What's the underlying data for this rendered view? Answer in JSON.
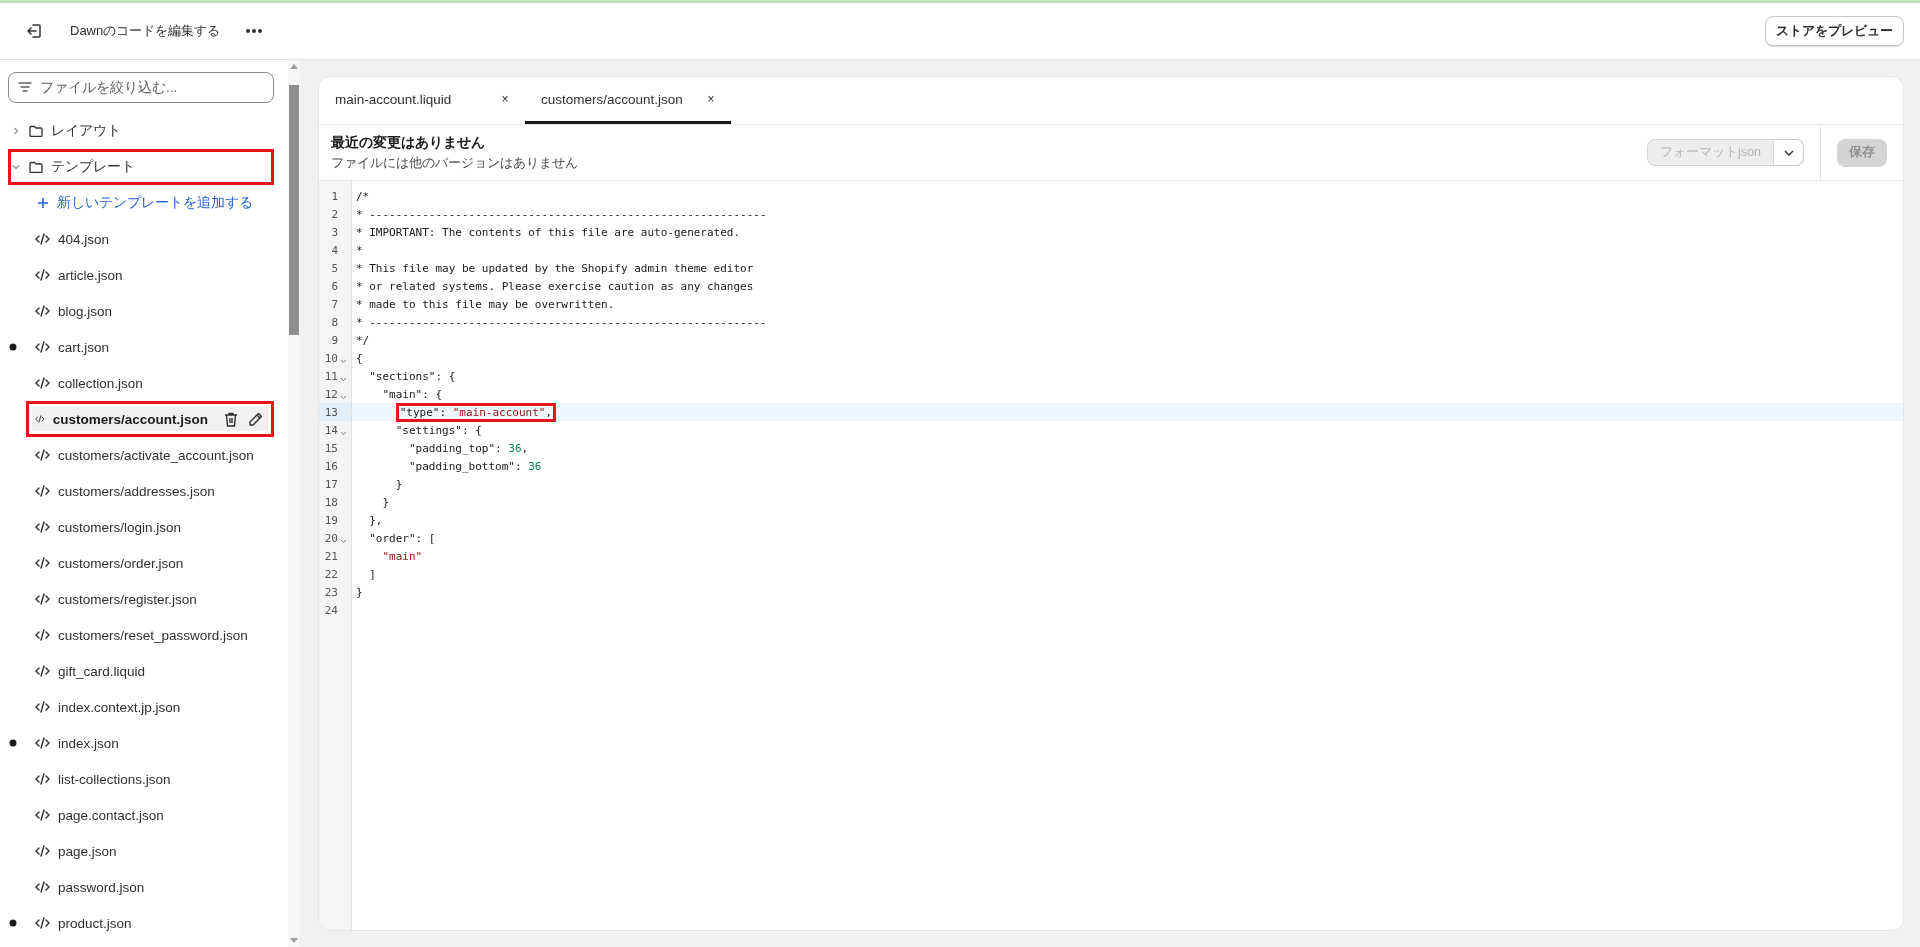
{
  "topbar": {
    "title": "Dawnのコードを編集する",
    "preview_button": "ストアをプレビュー"
  },
  "sidebar": {
    "filter": {
      "placeholder": "ファイルを絞り込む..."
    },
    "tree": [
      {
        "kind": "folder",
        "label": "レイアウト",
        "expanded": false,
        "annotated": false
      },
      {
        "kind": "folder",
        "label": "テンプレート",
        "expanded": true,
        "annotated": true,
        "children": [
          {
            "kind": "add",
            "label": "新しいテンプレートを追加する"
          },
          {
            "kind": "file",
            "label": "404.json",
            "modified": false,
            "selected": false,
            "annotated": false
          },
          {
            "kind": "file",
            "label": "article.json",
            "modified": false,
            "selected": false,
            "annotated": false
          },
          {
            "kind": "file",
            "label": "blog.json",
            "modified": false,
            "selected": false,
            "annotated": false
          },
          {
            "kind": "file",
            "label": "cart.json",
            "modified": true,
            "selected": false,
            "annotated": false
          },
          {
            "kind": "file",
            "label": "collection.json",
            "modified": false,
            "selected": false,
            "annotated": false
          },
          {
            "kind": "file",
            "label": "customers/account.json",
            "modified": false,
            "selected": true,
            "annotated": true
          },
          {
            "kind": "file",
            "label": "customers/activate_account.json",
            "modified": false,
            "selected": false,
            "annotated": false
          },
          {
            "kind": "file",
            "label": "customers/addresses.json",
            "modified": false,
            "selected": false,
            "annotated": false
          },
          {
            "kind": "file",
            "label": "customers/login.json",
            "modified": false,
            "selected": false,
            "annotated": false
          },
          {
            "kind": "file",
            "label": "customers/order.json",
            "modified": false,
            "selected": false,
            "annotated": false
          },
          {
            "kind": "file",
            "label": "customers/register.json",
            "modified": false,
            "selected": false,
            "annotated": false
          },
          {
            "kind": "file",
            "label": "customers/reset_password.json",
            "modified": false,
            "selected": false,
            "annotated": false
          },
          {
            "kind": "file",
            "label": "gift_card.liquid",
            "modified": false,
            "selected": false,
            "annotated": false
          },
          {
            "kind": "file",
            "label": "index.context.jp.json",
            "modified": false,
            "selected": false,
            "annotated": false
          },
          {
            "kind": "file",
            "label": "index.json",
            "modified": true,
            "selected": false,
            "annotated": false
          },
          {
            "kind": "file",
            "label": "list-collections.json",
            "modified": false,
            "selected": false,
            "annotated": false
          },
          {
            "kind": "file",
            "label": "page.contact.json",
            "modified": false,
            "selected": false,
            "annotated": false
          },
          {
            "kind": "file",
            "label": "page.json",
            "modified": false,
            "selected": false,
            "annotated": false
          },
          {
            "kind": "file",
            "label": "password.json",
            "modified": false,
            "selected": false,
            "annotated": false
          },
          {
            "kind": "file",
            "label": "product.json",
            "modified": true,
            "selected": false,
            "annotated": false
          }
        ]
      }
    ]
  },
  "editor": {
    "tabs": [
      {
        "label": "main-account.liquid",
        "close": "×",
        "selected": false
      },
      {
        "label": "customers/account.json",
        "close": "×",
        "selected": true
      }
    ],
    "header": {
      "title": "最近の変更はありません",
      "subtitle": "ファイルには他のバージョンはありません",
      "format_button": "フォーマットjson",
      "format_disabled": true,
      "save_button": "保存",
      "save_disabled": true
    },
    "lines": [
      {
        "number": "1",
        "tokens": [
          {
            "kind": "comment",
            "text": "/*"
          }
        ],
        "foldable": false,
        "current": false
      },
      {
        "number": "2",
        "tokens": [
          {
            "kind": "comment",
            "text": "* ------------------------------------------------------------"
          }
        ],
        "foldable": false,
        "current": false
      },
      {
        "number": "3",
        "tokens": [
          {
            "kind": "comment",
            "text": "* IMPORTANT: The contents of this file are auto-generated."
          }
        ],
        "foldable": false,
        "current": false
      },
      {
        "number": "4",
        "tokens": [
          {
            "kind": "comment",
            "text": "*"
          }
        ],
        "foldable": false,
        "current": false
      },
      {
        "number": "5",
        "tokens": [
          {
            "kind": "comment",
            "text": "* This file may be updated by the Shopify admin theme editor"
          }
        ],
        "foldable": false,
        "current": false
      },
      {
        "number": "6",
        "tokens": [
          {
            "kind": "comment",
            "text": "* or related systems. Please exercise caution as any changes"
          }
        ],
        "foldable": false,
        "current": false
      },
      {
        "number": "7",
        "tokens": [
          {
            "kind": "comment",
            "text": "* made to this file may be overwritten."
          }
        ],
        "foldable": false,
        "current": false
      },
      {
        "number": "8",
        "tokens": [
          {
            "kind": "comment",
            "text": "* ------------------------------------------------------------"
          }
        ],
        "foldable": false,
        "current": false
      },
      {
        "number": "9",
        "tokens": [
          {
            "kind": "comment",
            "text": "*/"
          }
        ],
        "foldable": false,
        "current": false
      },
      {
        "number": "10",
        "tokens": [
          {
            "kind": "punct",
            "text": "{"
          }
        ],
        "foldable": true,
        "current": false
      },
      {
        "number": "11",
        "tokens": [
          {
            "kind": "key",
            "text": "  \"sections\""
          },
          {
            "kind": "punct",
            "text": ": {"
          }
        ],
        "foldable": true,
        "current": false
      },
      {
        "number": "12",
        "tokens": [
          {
            "kind": "key",
            "text": "    \"main\""
          },
          {
            "kind": "punct",
            "text": ": {"
          }
        ],
        "foldable": true,
        "current": false
      },
      {
        "number": "13",
        "tokens": [
          {
            "kind": "annotation",
            "tokens": [
              {
                "kind": "key",
                "text": "      \"type\""
              },
              {
                "kind": "punct",
                "text": ": "
              },
              {
                "kind": "string",
                "text": "\"main-account\""
              },
              {
                "kind": "punct",
                "text": ","
              }
            ]
          }
        ],
        "foldable": false,
        "current": true
      },
      {
        "number": "14",
        "tokens": [
          {
            "kind": "key",
            "text": "      \"settings\""
          },
          {
            "kind": "punct",
            "text": ": {"
          }
        ],
        "foldable": true,
        "current": false
      },
      {
        "number": "15",
        "tokens": [
          {
            "kind": "key",
            "text": "        \"padding_top\""
          },
          {
            "kind": "punct",
            "text": ": "
          },
          {
            "kind": "number",
            "text": "36"
          },
          {
            "kind": "punct",
            "text": ","
          }
        ],
        "foldable": false,
        "current": false
      },
      {
        "number": "16",
        "tokens": [
          {
            "kind": "key",
            "text": "        \"padding_bottom\""
          },
          {
            "kind": "punct",
            "text": ": "
          },
          {
            "kind": "number",
            "text": "36"
          }
        ],
        "foldable": false,
        "current": false
      },
      {
        "number": "17",
        "tokens": [
          {
            "kind": "punct",
            "text": "      }"
          }
        ],
        "foldable": false,
        "current": false
      },
      {
        "number": "18",
        "tokens": [
          {
            "kind": "punct",
            "text": "    }"
          }
        ],
        "foldable": false,
        "current": false
      },
      {
        "number": "19",
        "tokens": [
          {
            "kind": "punct",
            "text": "  },"
          }
        ],
        "foldable": false,
        "current": false
      },
      {
        "number": "20",
        "tokens": [
          {
            "kind": "key",
            "text": "  \"order\""
          },
          {
            "kind": "punct",
            "text": ": ["
          }
        ],
        "foldable": true,
        "current": false
      },
      {
        "number": "21",
        "tokens": [
          {
            "kind": "string",
            "text": "    \"main\""
          }
        ],
        "foldable": false,
        "current": false
      },
      {
        "number": "22",
        "tokens": [
          {
            "kind": "punct",
            "text": "  ]"
          }
        ],
        "foldable": false,
        "current": false
      },
      {
        "number": "23",
        "tokens": [
          {
            "kind": "punct",
            "text": "}"
          }
        ],
        "foldable": false,
        "current": false
      },
      {
        "number": "24",
        "foldable": false,
        "current": false
      }
    ]
  }
}
